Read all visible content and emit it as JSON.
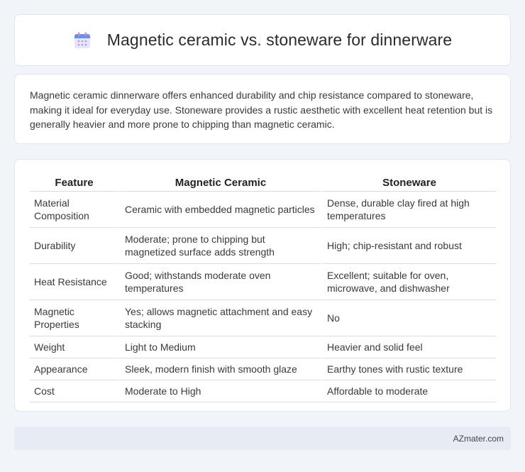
{
  "header": {
    "title": "Magnetic ceramic vs. stoneware for dinnerware",
    "icon": "calendar-icon"
  },
  "summary": {
    "text": "Magnetic ceramic dinnerware offers enhanced durability and chip resistance compared to stoneware, making it ideal for everyday use. Stoneware provides a rustic aesthetic with excellent heat retention but is generally heavier and more prone to chipping than magnetic ceramic."
  },
  "table": {
    "headers": [
      "Feature",
      "Magnetic Ceramic",
      "Stoneware"
    ],
    "rows": [
      [
        "Material Composition",
        "Ceramic with embedded magnetic particles",
        "Dense, durable clay fired at high temperatures"
      ],
      [
        "Durability",
        "Moderate; prone to chipping but magnetized surface adds strength",
        "High; chip-resistant and robust"
      ],
      [
        "Heat Resistance",
        "Good; withstands moderate oven temperatures",
        "Excellent; suitable for oven, microwave, and dishwasher"
      ],
      [
        "Magnetic Properties",
        "Yes; allows magnetic attachment and easy stacking",
        "No"
      ],
      [
        "Weight",
        "Light to Medium",
        "Heavier and solid feel"
      ],
      [
        "Appearance",
        "Sleek, modern finish with smooth glaze",
        "Earthy tones with rustic texture"
      ],
      [
        "Cost",
        "Moderate to High",
        "Affordable to moderate"
      ]
    ]
  },
  "footer": {
    "brand": "AZmater.com"
  },
  "colors": {
    "page_background": "#f1f4f9",
    "footer_background": "#e6ebf4",
    "icon_accent": "#6b8ff0"
  }
}
